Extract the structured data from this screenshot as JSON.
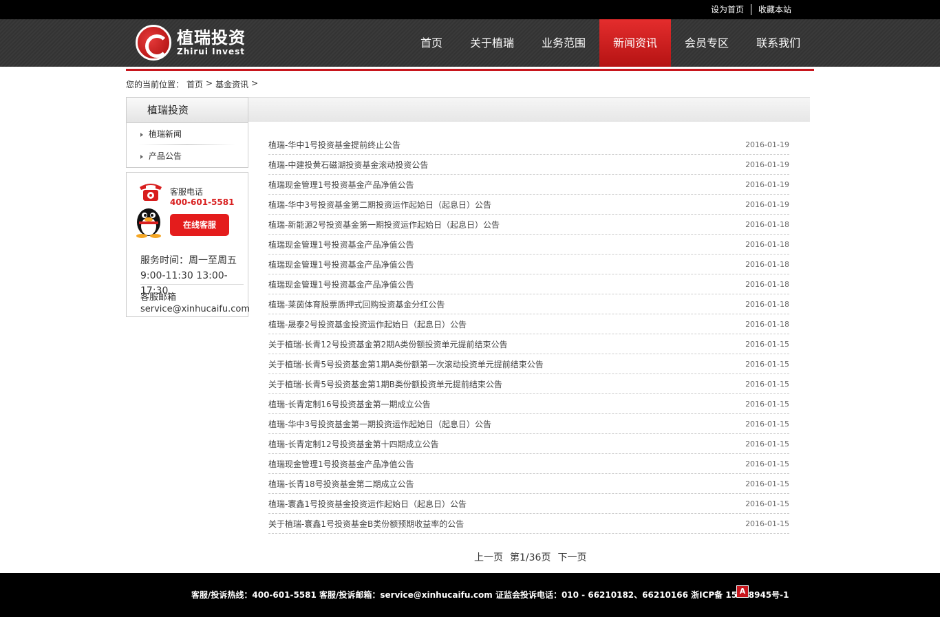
{
  "topbar": {
    "links": [
      "设为首页",
      "收藏本站"
    ]
  },
  "logo": {
    "cn": "植瑞投资",
    "en": "Zhirui Invest"
  },
  "nav": [
    "首页",
    "关于植瑞",
    "业务范围",
    "新闻资讯",
    "会员专区",
    "联系我们"
  ],
  "breadcrumb": {
    "prefix": "您的当前位置：",
    "home": "首页",
    "sep": ">",
    "section": "基金资讯"
  },
  "sidebar": {
    "title": "植瑞投资",
    "items": [
      "植瑞新闻",
      "产品公告"
    ]
  },
  "service": {
    "phone_label": "客服电话",
    "phone": "400-601-5581",
    "online_button": "在线客服",
    "hours_label": "服务时间：周一至周五",
    "hours": "9:00-11:30 13:00-17:30",
    "mail_label": "客服邮箱",
    "mail": "service@xinhucaifu.com"
  },
  "news": [
    {
      "title": "植瑞-华中1号投资基金提前终止公告",
      "date": "2016-01-19"
    },
    {
      "title": "植瑞-中建投黄石磁湖投资基金滚动投资公告",
      "date": "2016-01-19"
    },
    {
      "title": "植瑞现金管理1号投资基金产品净值公告",
      "date": "2016-01-19"
    },
    {
      "title": "植瑞-华中3号投资基金第二期投资运作起始日（起息日）公告",
      "date": "2016-01-19"
    },
    {
      "title": "植瑞-新能源2号投资基金第一期投资运作起始日（起息日）公告",
      "date": "2016-01-18"
    },
    {
      "title": "植瑞现金管理1号投资基金产品净值公告",
      "date": "2016-01-18"
    },
    {
      "title": "植瑞现金管理1号投资基金产品净值公告",
      "date": "2016-01-18"
    },
    {
      "title": "植瑞现金管理1号投资基金产品净值公告",
      "date": "2016-01-18"
    },
    {
      "title": "植瑞-莱茵体育股票质押式回购投资基金分红公告",
      "date": "2016-01-18"
    },
    {
      "title": "植瑞-晟泰2号投资基金投资运作起始日（起息日）公告",
      "date": "2016-01-18"
    },
    {
      "title": "关于植瑞-长青12号投资基金第2期A类份额投资单元提前结束公告",
      "date": "2016-01-15"
    },
    {
      "title": "关于植瑞-长青5号投资基金第1期A类份额第一次滚动投资单元提前结束公告",
      "date": "2016-01-15"
    },
    {
      "title": "关于植瑞-长青5号投资基金第1期B类份额投资单元提前结束公告",
      "date": "2016-01-15"
    },
    {
      "title": "植瑞-长青定制16号投资基金第一期成立公告",
      "date": "2016-01-15"
    },
    {
      "title": "植瑞-华中3号投资基金第一期投资运作起始日（起息日）公告",
      "date": "2016-01-15"
    },
    {
      "title": "植瑞-长青定制12号投资基金第十四期成立公告",
      "date": "2016-01-15"
    },
    {
      "title": "植瑞现金管理1号投资基金产品净值公告",
      "date": "2016-01-15"
    },
    {
      "title": "植瑞-长青18号投资基金第二期成立公告",
      "date": "2016-01-15"
    },
    {
      "title": "植瑞-寰鑫1号投资基金投资运作起始日（起息日）公告",
      "date": "2016-01-15"
    },
    {
      "title": "关于植瑞-寰鑫1号投资基金B类份额预期收益率的公告",
      "date": "2016-01-15"
    }
  ],
  "pager": {
    "prev": "上一页",
    "info": "第1/36页",
    "next": "下一页"
  },
  "footer": {
    "text": "客服/投诉热线：400-601-5581 客服/投诉邮箱：service@xinhucaifu.com 证监会投诉电话：010 - 66210182、66210166 浙ICP备 15008945号-1",
    "badge": "A"
  },
  "colors": {
    "brand_red": "#c8161d",
    "nav_active": "#e42d2d",
    "dark": "#000000"
  }
}
